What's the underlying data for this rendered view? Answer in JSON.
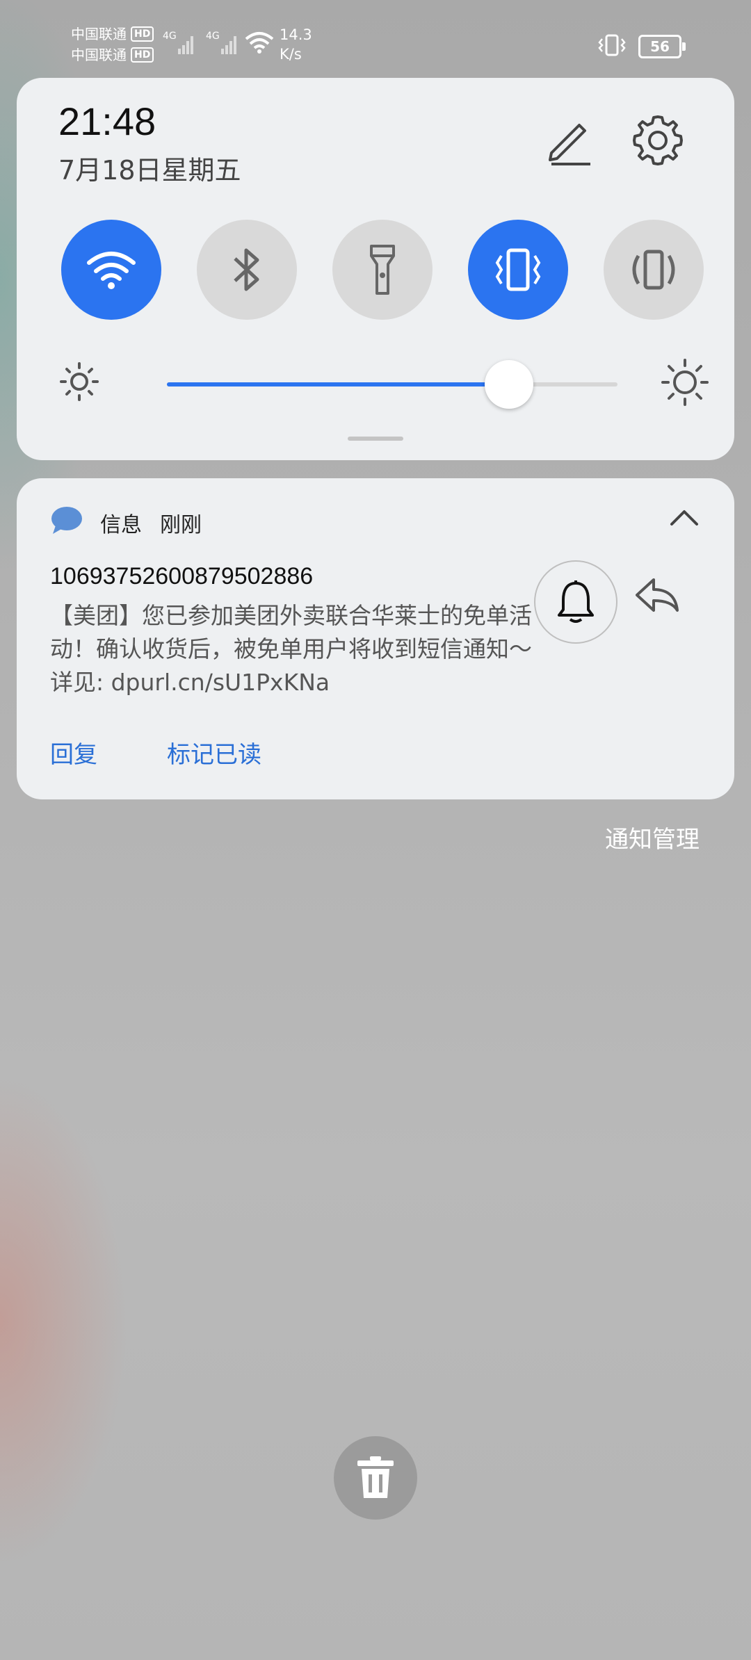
{
  "status_bar": {
    "carrier1": "中国联通",
    "carrier2": "中国联通",
    "hd": "HD",
    "network1": "4G",
    "network2": "4G",
    "speed_value": "14.3",
    "speed_unit": "K/s",
    "battery": "56"
  },
  "quick_panel": {
    "time": "21:48",
    "date": "7月18日星期五",
    "toggles": [
      {
        "icon": "wifi-icon",
        "on": true
      },
      {
        "icon": "bluetooth-icon",
        "on": false
      },
      {
        "icon": "flashlight-icon",
        "on": false
      },
      {
        "icon": "vibrate-icon",
        "on": true
      },
      {
        "icon": "auto-rotate-icon",
        "on": false
      }
    ],
    "brightness_level": 0.76,
    "accent_color": "#2b74f0"
  },
  "notification": {
    "app_name": "信息",
    "time": "刚刚",
    "sender": "10693752600879502886",
    "body": "【美团】您已参加美团外卖联合华莱士的免单活动！确认收货后，被免单用户将收到短信通知～详见: dpurl.cn/sU1PxKNa",
    "action_reply": "回复",
    "action_mark_read": "标记已读"
  },
  "manage_notifications": "通知管理"
}
